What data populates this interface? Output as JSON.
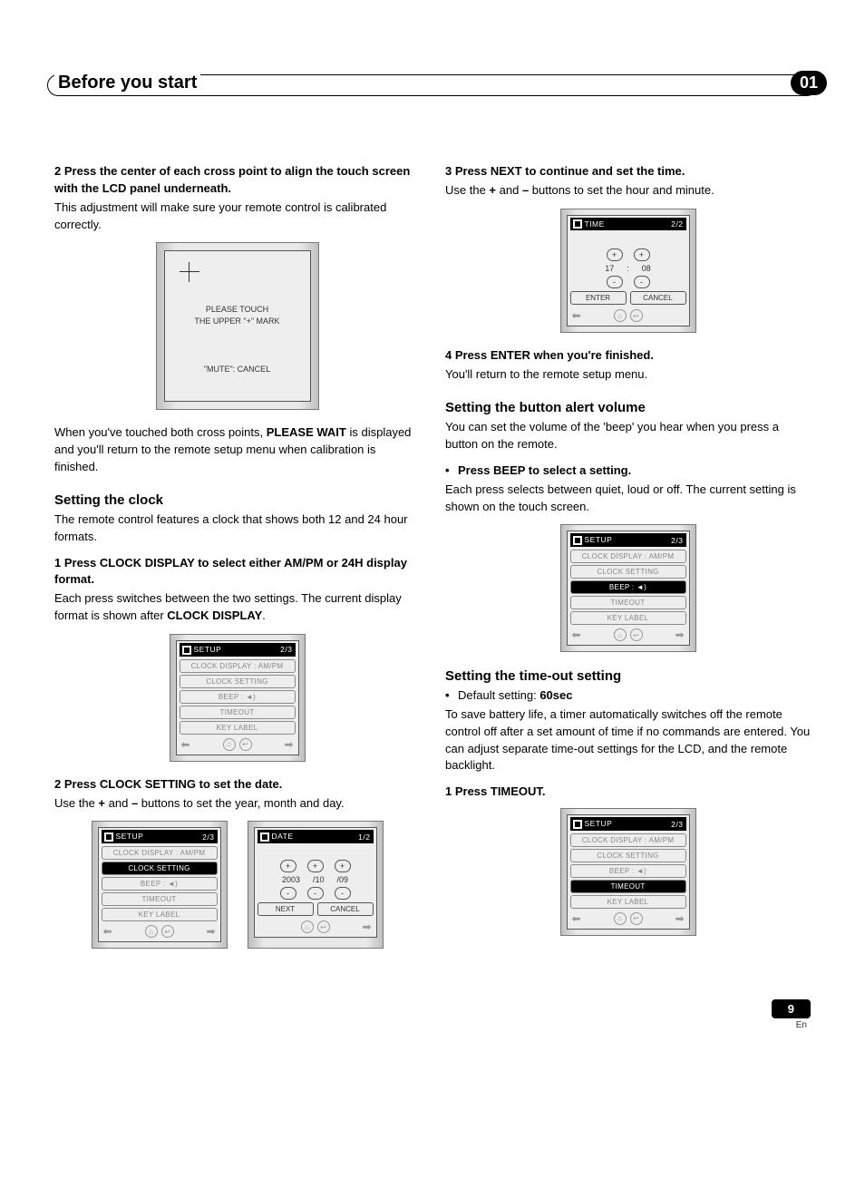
{
  "header": {
    "title": "Before you start",
    "chapter": "01"
  },
  "left": {
    "step2_title": "2   Press the center of each cross point to align the touch screen with the LCD panel underneath.",
    "step2_body": "This adjustment will make sure your remote control is calibrated correctly.",
    "calib_line1": "PLEASE TOUCH",
    "calib_line2": "THE UPPER \"+\" MARK",
    "calib_cancel": "\"MUTE\": CANCEL",
    "after_calib": "When you've touched both cross points, ",
    "after_calib_bold": "PLEASE WAIT",
    "after_calib2": " is displayed and you'll return to the remote setup menu when calibration is finished.",
    "clock_head": "Setting the clock",
    "clock_body": "The remote control features a clock that shows both 12 and 24 hour formats.",
    "clock_step1": "1   Press CLOCK DISPLAY to select either AM/PM or 24H display format.",
    "clock_step1_body_a": "Each press switches between the two settings. The current display format is shown after ",
    "clock_step1_body_bold": "CLOCK DISPLAY",
    "clock_step1_body_b": ".",
    "clock_step2": "2   Press CLOCK SETTING to set the date.",
    "clock_step2_body_a": "Use the ",
    "clock_step2_body_b": " and ",
    "clock_step2_body_c": " buttons to set the year, month and day.",
    "plus": "+",
    "minus": "–",
    "setup_menu": {
      "title": "SETUP",
      "page": "2/3",
      "items": [
        "CLOCK  DISPLAY : AM/PM",
        "CLOCK  SETTING",
        "BEEP :  ",
        "TIMEOUT",
        "KEY  LABEL"
      ]
    },
    "date_menu": {
      "title": "DATE",
      "page": "1/2",
      "vals": [
        "2003",
        "/10",
        "/09"
      ],
      "next": "NEXT",
      "cancel": "CANCEL"
    }
  },
  "right": {
    "step3_title": "3   Press NEXT to continue and set the time.",
    "step3_body_a": "Use the ",
    "step3_body_b": " and ",
    "step3_body_c": " buttons to set the hour and minute.",
    "plus": "+",
    "minus": "–",
    "time_menu": {
      "title": "TIME",
      "page": "2/2",
      "hour": "17",
      "sep": ":",
      "min": "08",
      "enter": "ENTER",
      "cancel": "CANCEL"
    },
    "step4_title": "4   Press ENTER when you're finished.",
    "step4_body": "You'll return to the remote setup menu.",
    "vol_head": "Setting the button alert volume",
    "vol_body": "You can set the volume of the 'beep' you hear when you press a button on the remote.",
    "vol_bullet": "Press BEEP to select a setting.",
    "vol_body2": "Each press selects between quiet, loud or off. The current setting is shown on the touch screen.",
    "timeout_head": "Setting the time-out setting",
    "timeout_bullet_a": "Default setting: ",
    "timeout_bullet_b": "60sec",
    "timeout_body": "To save battery life, a timer automatically switches off the remote control off after a set amount of time if no commands are entered. You can adjust separate time-out settings for the LCD, and the remote backlight.",
    "timeout_step1": "1   Press TIMEOUT."
  },
  "footer": {
    "number": "9",
    "lang": "En"
  }
}
